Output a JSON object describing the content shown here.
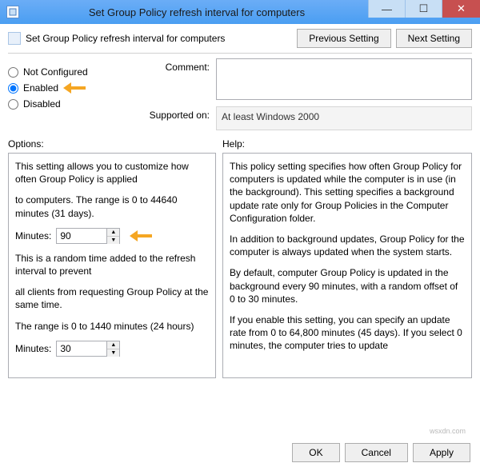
{
  "window": {
    "title": "Set Group Policy refresh interval for computers"
  },
  "header": {
    "title": "Set Group Policy refresh interval for computers",
    "prev_btn": "Previous Setting",
    "next_btn": "Next Setting"
  },
  "state": {
    "not_configured": "Not Configured",
    "enabled": "Enabled",
    "disabled": "Disabled",
    "selected": "enabled"
  },
  "meta": {
    "comment_label": "Comment:",
    "comment_value": "",
    "supported_label": "Supported on:",
    "supported_value": "At least Windows 2000"
  },
  "options": {
    "label": "Options:",
    "intro1": "This setting allows you to customize how often Group Policy is applied",
    "intro2": "to computers. The range is 0 to 44640 minutes (31 days).",
    "minutes1_label": "Minutes:",
    "minutes1_value": "90",
    "random1": "This is a random time added to the refresh interval to prevent",
    "random2": "all clients from requesting Group Policy at the same time.",
    "range2": "The range is 0 to 1440 minutes (24 hours)",
    "minutes2_label": "Minutes:",
    "minutes2_value": "30"
  },
  "help": {
    "label": "Help:",
    "p1": "This policy setting specifies how often Group Policy for computers is updated while the computer is in use (in the background). This setting specifies a background update rate only for Group Policies in the Computer Configuration folder.",
    "p2": "In addition to background updates, Group Policy for the computer is always updated when the system starts.",
    "p3": "By default, computer Group Policy is updated in the background every 90 minutes, with a random offset of 0 to 30 minutes.",
    "p4": "If you enable this setting, you can specify an update rate from 0 to 64,800 minutes (45 days). If you select 0 minutes, the computer tries to update"
  },
  "footer": {
    "ok": "OK",
    "cancel": "Cancel",
    "apply": "Apply"
  },
  "watermark": "wsxdn.com"
}
